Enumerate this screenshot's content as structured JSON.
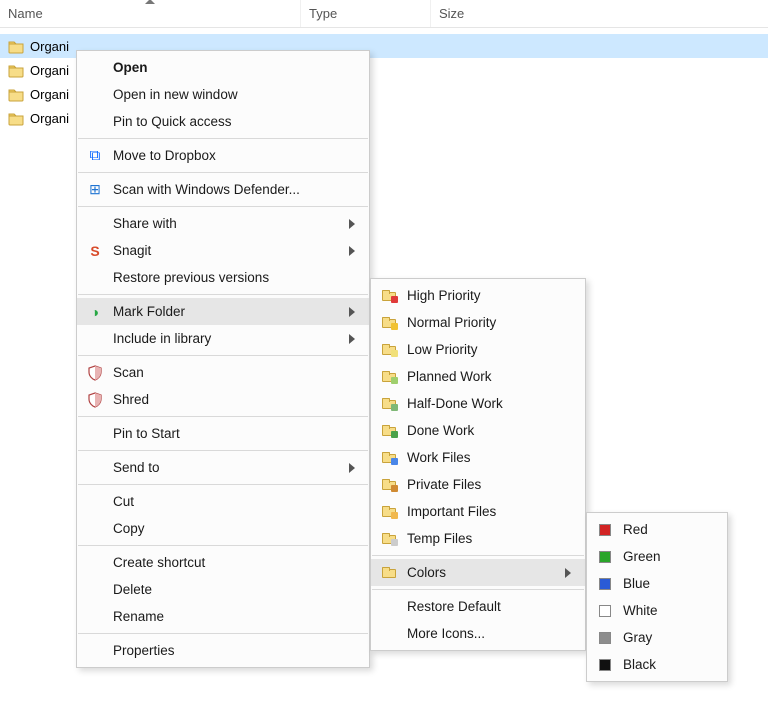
{
  "columns": {
    "name": "Name",
    "type": "Type",
    "size": "Size"
  },
  "files": {
    "items": [
      {
        "name": "Organi"
      },
      {
        "name": "Organi"
      },
      {
        "name": "Organi"
      },
      {
        "name": "Organi"
      }
    ]
  },
  "ctx_main": {
    "open": "Open",
    "open_new_window": "Open in new window",
    "pin_quick_access": "Pin to Quick access",
    "move_to_dropbox": "Move to Dropbox",
    "scan_defender": "Scan with Windows Defender...",
    "share_with": "Share with",
    "snagit": "Snagit",
    "restore_prev": "Restore previous versions",
    "mark_folder": "Mark Folder",
    "include_library": "Include in library",
    "scan": "Scan",
    "shred": "Shred",
    "pin_start": "Pin to Start",
    "send_to": "Send to",
    "cut": "Cut",
    "copy": "Copy",
    "create_shortcut": "Create shortcut",
    "delete": "Delete",
    "rename": "Rename",
    "properties": "Properties"
  },
  "ctx_mark": {
    "high_priority": "High Priority",
    "normal_priority": "Normal Priority",
    "low_priority": "Low Priority",
    "planned_work": "Planned Work",
    "half_done": "Half-Done Work",
    "done_work": "Done Work",
    "work_files": "Work Files",
    "private_files": "Private Files",
    "important_files": "Important Files",
    "temp_files": "Temp Files",
    "colors": "Colors",
    "restore_default": "Restore Default",
    "more_icons": "More Icons..."
  },
  "ctx_colors": {
    "red": {
      "label": "Red",
      "hex": "#d22424"
    },
    "green": {
      "label": "Green",
      "hex": "#2aa52a"
    },
    "blue": {
      "label": "Blue",
      "hex": "#2a5bd6"
    },
    "white": {
      "label": "White",
      "hex": "#ffffff"
    },
    "gray": {
      "label": "Gray",
      "hex": "#8d8d8d"
    },
    "black": {
      "label": "Black",
      "hex": "#111111"
    }
  },
  "mark_icon_colors": {
    "high_priority": "#e03a3a",
    "normal_priority": "#f1c232",
    "low_priority": "#f1e079",
    "planned_work": "#9fcf6d",
    "half_done": "#7fb876",
    "done_work": "#4aa14a",
    "work_files": "#4a86e8",
    "private_files": "#d08b33",
    "important_files": "#f1b84d",
    "temp_files": "#cccccc",
    "colors": "#ffffff"
  }
}
